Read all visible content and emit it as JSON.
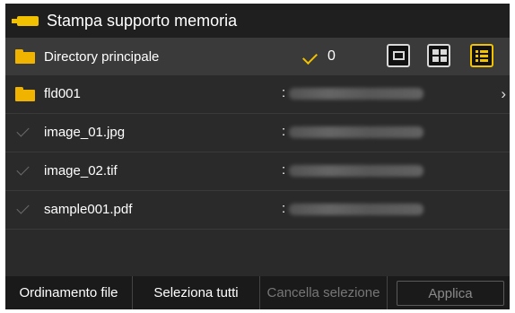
{
  "header": {
    "title": "Stampa supporto memoria",
    "accent_color": "#f2c200"
  },
  "directory": {
    "label": "Directory principale",
    "selected_count": "0",
    "view_modes": [
      "single",
      "grid",
      "list"
    ],
    "active_view": "list"
  },
  "files": [
    {
      "name": "fld001",
      "type": "folder",
      "separator": ":",
      "has_chevron": true
    },
    {
      "name": "image_01.jpg",
      "type": "file",
      "separator": ":"
    },
    {
      "name": "image_02.tif",
      "type": "file",
      "separator": ":"
    },
    {
      "name": "sample001.pdf",
      "type": "file",
      "separator": ":"
    }
  ],
  "chevron_glyph": "›",
  "footer": {
    "sort_label": "Ordinamento file",
    "select_all_label": "Seleziona tutti",
    "clear_label": "Cancella selezione",
    "apply_label": "Applica"
  }
}
